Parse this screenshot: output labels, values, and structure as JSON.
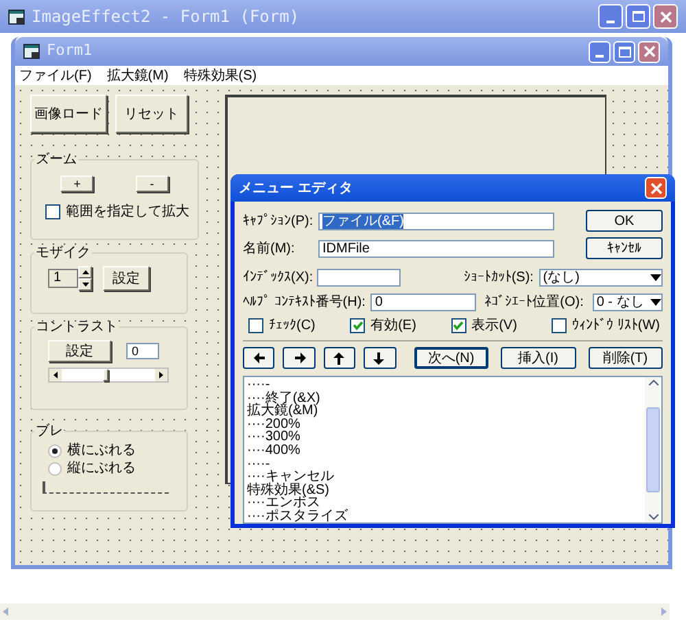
{
  "window": {
    "title": "ImageEffect2 - Form1 (Form)"
  },
  "form": {
    "title": "Form1",
    "menu": [
      "ファイル(F)",
      "拡大鏡(M)",
      "特殊効果(S)"
    ],
    "buttons": [
      "画像ロード",
      "リセット"
    ],
    "zoom": {
      "title": "ズーム",
      "buttons": [
        "+",
        "-"
      ],
      "checkbox": {
        "label": "範囲を指定して拡大",
        "checked": false
      }
    },
    "mosaic": {
      "title": "モザイク",
      "value": "1",
      "button": "設定"
    },
    "contrast": {
      "title": "コントラスト",
      "button": "設定",
      "value": "0"
    },
    "blur": {
      "title": "ブレ",
      "radios": [
        {
          "label": "横にぶれる",
          "selected": true
        },
        {
          "label": "縦にぶれる",
          "selected": false
        }
      ],
      "slider": {
        "level": 0
      }
    }
  },
  "dialog": {
    "title": "メニュー エディタ",
    "caption": {
      "label": "ｷｬﾌﾟｼｮﾝ(P):",
      "value": "ファイル(&F)"
    },
    "name": {
      "label": "名前(M):",
      "value": "IDMFile"
    },
    "index": {
      "label": "ｲﾝﾃﾞｯｸｽ(X):"
    },
    "shortcut": {
      "label": "ｼｮｰﾄｶｯﾄ(S):",
      "value": "(なし)"
    },
    "help": {
      "label": "ﾍﾙﾌﾟ ｺﾝﾃｷｽﾄ番号(H):",
      "value": "0"
    },
    "negotiate": {
      "label": "ﾈｺﾞｼｴｰﾄ位置(O):",
      "value": "0 - なし"
    },
    "ok": "OK",
    "cancel": "ｷｬﾝｾﾙ",
    "checkboxes": [
      {
        "label": "ﾁｪｯｸ(C)",
        "checked": false
      },
      {
        "label": "有効(E)",
        "checked": true
      },
      {
        "label": "表示(V)",
        "checked": true
      },
      {
        "label": "ｳｨﾝﾄﾞｳ ﾘｽﾄ(W)",
        "checked": false
      }
    ],
    "arrows": [
      {
        "kind": "left"
      },
      {
        "kind": "right"
      },
      {
        "kind": "up"
      },
      {
        "kind": "down"
      }
    ],
    "actions": [
      "次へ(N)",
      "挿入(I)",
      "削除(T)"
    ],
    "items": [
      "····-",
      "····終了(&X)",
      "拡大鏡(&M)",
      "····200%",
      "····300%",
      "····400%",
      "····-",
      "····キャンセル",
      "特殊効果(&S)",
      "····エンボス",
      "····ポスタライズ"
    ]
  }
}
